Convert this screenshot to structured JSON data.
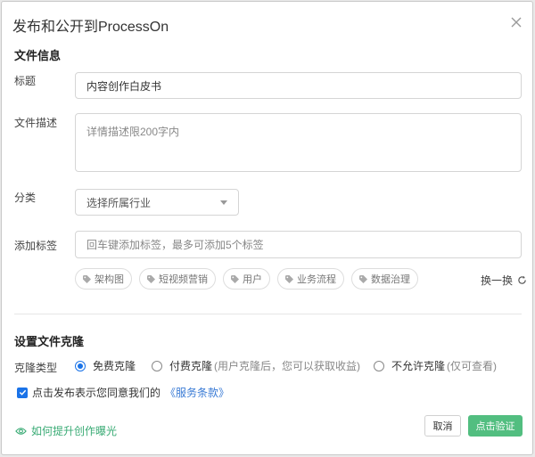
{
  "dialog": {
    "title": "发布和公开到ProcessOn"
  },
  "file_info": {
    "section_title": "文件信息",
    "title_label": "标题",
    "title_value": "内容创作白皮书",
    "desc_label": "文件描述",
    "desc_placeholder": "详情描述限200字内",
    "category_label": "分类",
    "category_placeholder": "选择所属行业",
    "tags_label": "添加标签",
    "tags_placeholder": "回车键添加标签，最多可添加5个标签",
    "suggested_tags": [
      "架构图",
      "短视频营销",
      "用户",
      "业务流程",
      "数据治理"
    ],
    "refresh_label": "换一换"
  },
  "clone": {
    "section_title": "设置文件克隆",
    "type_label": "克隆类型",
    "options": [
      {
        "label": "免费克隆",
        "note": "",
        "selected": true
      },
      {
        "label": "付费克隆",
        "note": "(用户克隆后，您可以获取收益)",
        "selected": false
      },
      {
        "label": "不允许克隆",
        "note": "(仅可查看)",
        "selected": false
      }
    ]
  },
  "agreement": {
    "checked": true,
    "text": "点击发布表示您同意我们的",
    "link": "《服务条款》"
  },
  "footer": {
    "help_link": "如何提升创作曝光",
    "cancel_label": "取消",
    "confirm_label": "点击验证"
  },
  "colors": {
    "accent_blue": "#1a73e8",
    "confirm_green": "#52be80",
    "help_green": "#3aab75"
  }
}
